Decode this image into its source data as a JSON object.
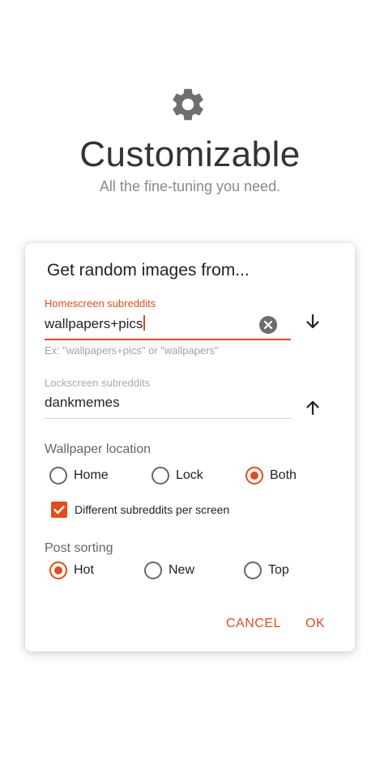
{
  "hero": {
    "icon": "gear-icon",
    "title": "Customizable",
    "subtitle": "All the fine-tuning you need."
  },
  "dialog": {
    "title": "Get random images from...",
    "homescreen": {
      "label": "Homescreen subreddits",
      "value": "wallpapers+pics",
      "helper": "Ex: \"wallpapers+pics\" or \"wallpapers\""
    },
    "lockscreen": {
      "label": "Lockscreen subreddits",
      "value": "dankmemes"
    },
    "wallpaper_location": {
      "label": "Wallpaper location",
      "options": [
        "Home",
        "Lock",
        "Both"
      ],
      "selected": "Both"
    },
    "different_per_screen": {
      "label": "Different subreddits per screen",
      "checked": true
    },
    "post_sorting": {
      "label": "Post sorting",
      "options": [
        "Hot",
        "New",
        "Top"
      ],
      "selected": "Hot"
    },
    "actions": {
      "cancel": "CANCEL",
      "ok": "OK"
    }
  },
  "colors": {
    "accent": "#e64a19",
    "title_text": "#333333",
    "muted_text": "#8a8a8a"
  }
}
